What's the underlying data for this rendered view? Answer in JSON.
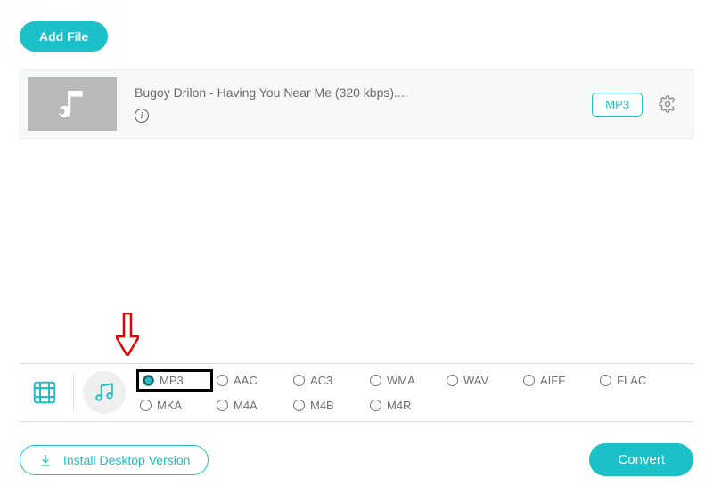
{
  "header": {
    "add_file_label": "Add File"
  },
  "file": {
    "title": "Bugoy Drilon - Having You Near Me (320 kbps)....",
    "format_badge": "MP3"
  },
  "format_panel": {
    "selected": "MP3",
    "options_row1": [
      "MP3",
      "AAC",
      "AC3",
      "WMA",
      "WAV",
      "AIFF",
      "FLAC"
    ],
    "options_row2": [
      "MKA",
      "M4A",
      "M4B",
      "M4R"
    ]
  },
  "footer": {
    "install_label": "Install Desktop Version",
    "convert_label": "Convert"
  },
  "colors": {
    "accent": "#1bc0c8",
    "arrow": "#e60000"
  }
}
